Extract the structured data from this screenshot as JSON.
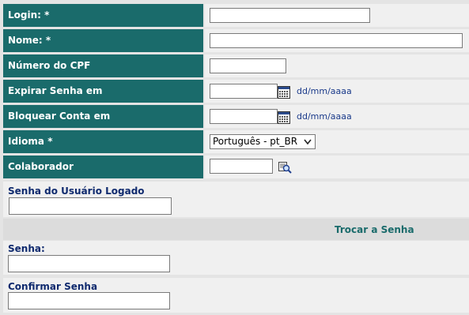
{
  "form": {
    "login_label": "Login: *",
    "nome_label": "Nome: *",
    "cpf_label": "Número do CPF",
    "expirar_label": "Expirar Senha em",
    "expirar_hint": "dd/mm/aaaa",
    "bloquear_label": "Bloquear Conta em",
    "bloquear_hint": "dd/mm/aaaa",
    "idioma_label": "Idioma *",
    "idioma_selected": "Português - pt_BR",
    "colaborador_label": "Colaborador",
    "login_value": "",
    "nome_value": "",
    "cpf_value": "",
    "expirar_value": "",
    "bloquear_value": "",
    "colaborador_value": ""
  },
  "password": {
    "logged_user_label": "Senha do Usuário Logado",
    "logged_user_value": "",
    "change_title": "Trocar a Senha",
    "senha_label": "Senha:",
    "senha_value": "",
    "confirmar_label": "Confirmar Senha",
    "confirmar_value": ""
  },
  "colors": {
    "label_bg": "#1a6b6b",
    "hint_text": "#1a3a8a",
    "section_title": "#0f2a6e"
  },
  "icons": {
    "calendar": "calendar-icon",
    "lookup": "search-user-icon",
    "dropdown": "chevron-down-icon"
  }
}
